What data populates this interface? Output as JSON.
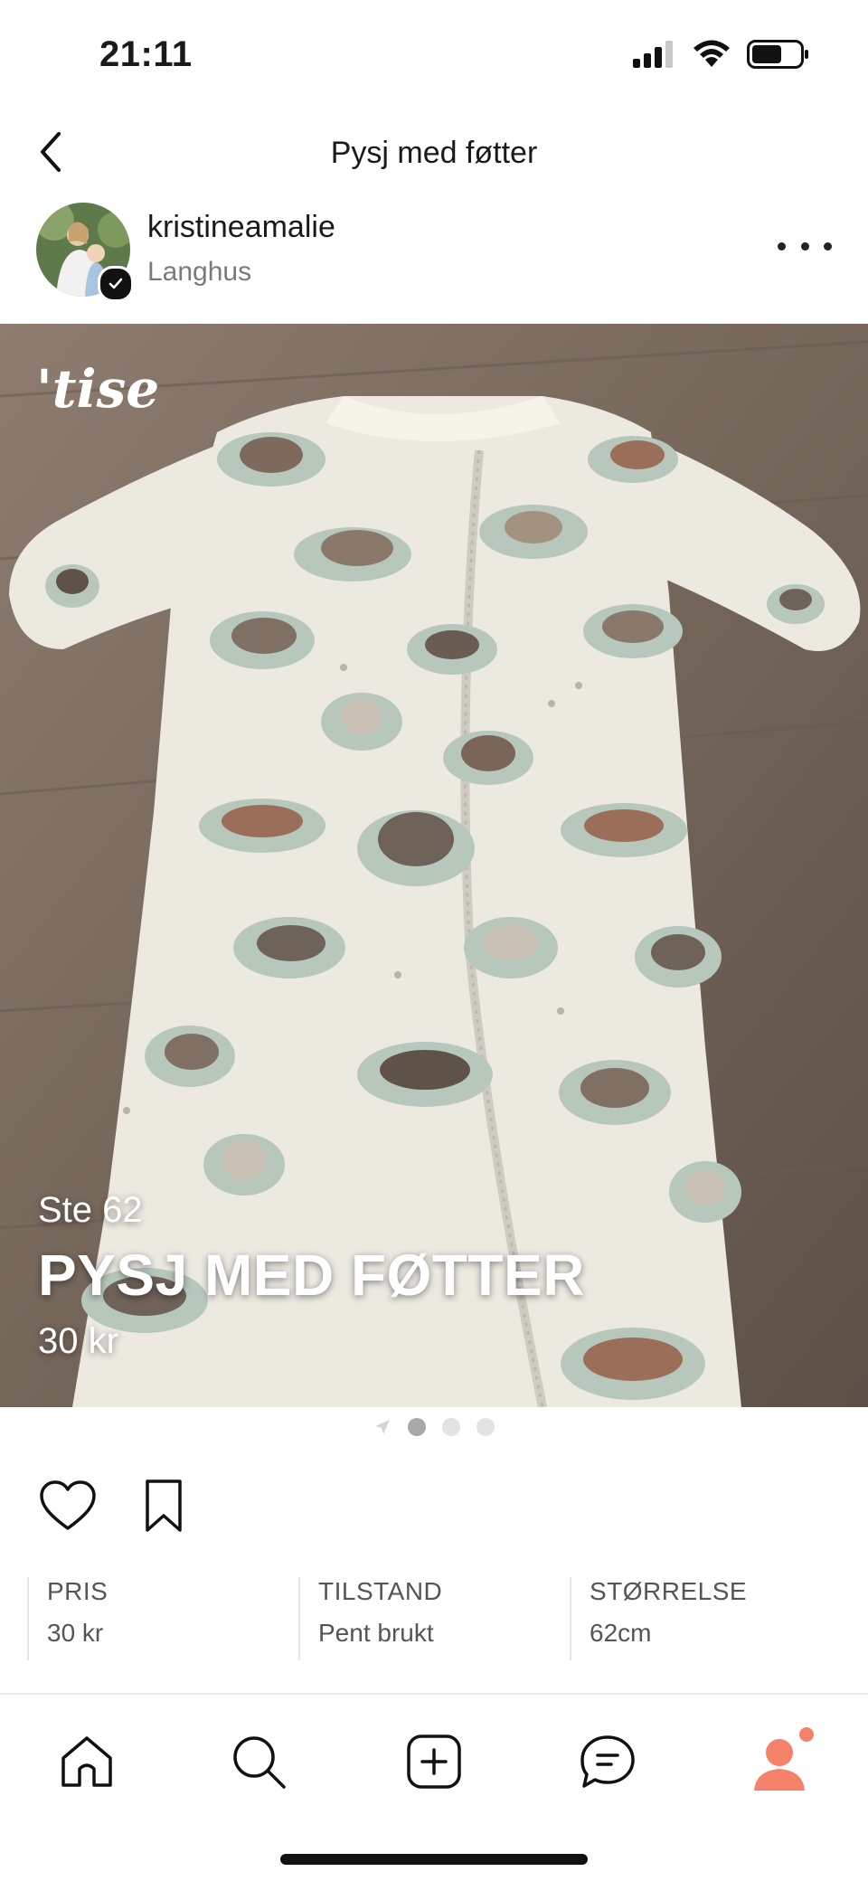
{
  "status": {
    "time": "21:11",
    "signal_icon": "cellular-signal-icon",
    "wifi_icon": "wifi-icon",
    "battery_icon": "battery-icon"
  },
  "header": {
    "title": "Pysj med føtter",
    "back_icon": "chevron-left-icon"
  },
  "seller": {
    "name": "kristineamalie",
    "location": "Langhus",
    "verified": true,
    "more_icon": "more-horizontal-icon"
  },
  "photo": {
    "logo_text": "'tise",
    "caption_size": "Ste 62",
    "caption_title": "PYSJ MED FØTTER",
    "caption_price": "30 kr",
    "page_count": 3,
    "current_page": 1
  },
  "actions": {
    "like_icon": "heart-icon",
    "save_icon": "bookmark-icon"
  },
  "details": [
    {
      "label": "PRIS",
      "value": "30 kr"
    },
    {
      "label": "TILSTAND",
      "value": "Pent brukt"
    },
    {
      "label": "STØRRELSE",
      "value": "62cm"
    }
  ],
  "tabs": [
    {
      "name": "home",
      "icon": "home-icon"
    },
    {
      "name": "search",
      "icon": "search-icon"
    },
    {
      "name": "add",
      "icon": "plus-square-icon"
    },
    {
      "name": "messages",
      "icon": "chat-icon"
    },
    {
      "name": "profile",
      "icon": "profile-icon",
      "notification": true
    }
  ],
  "colors": {
    "accent": "#f4826b",
    "wood": "#7a6a5e",
    "fabric": "#eceae2"
  }
}
